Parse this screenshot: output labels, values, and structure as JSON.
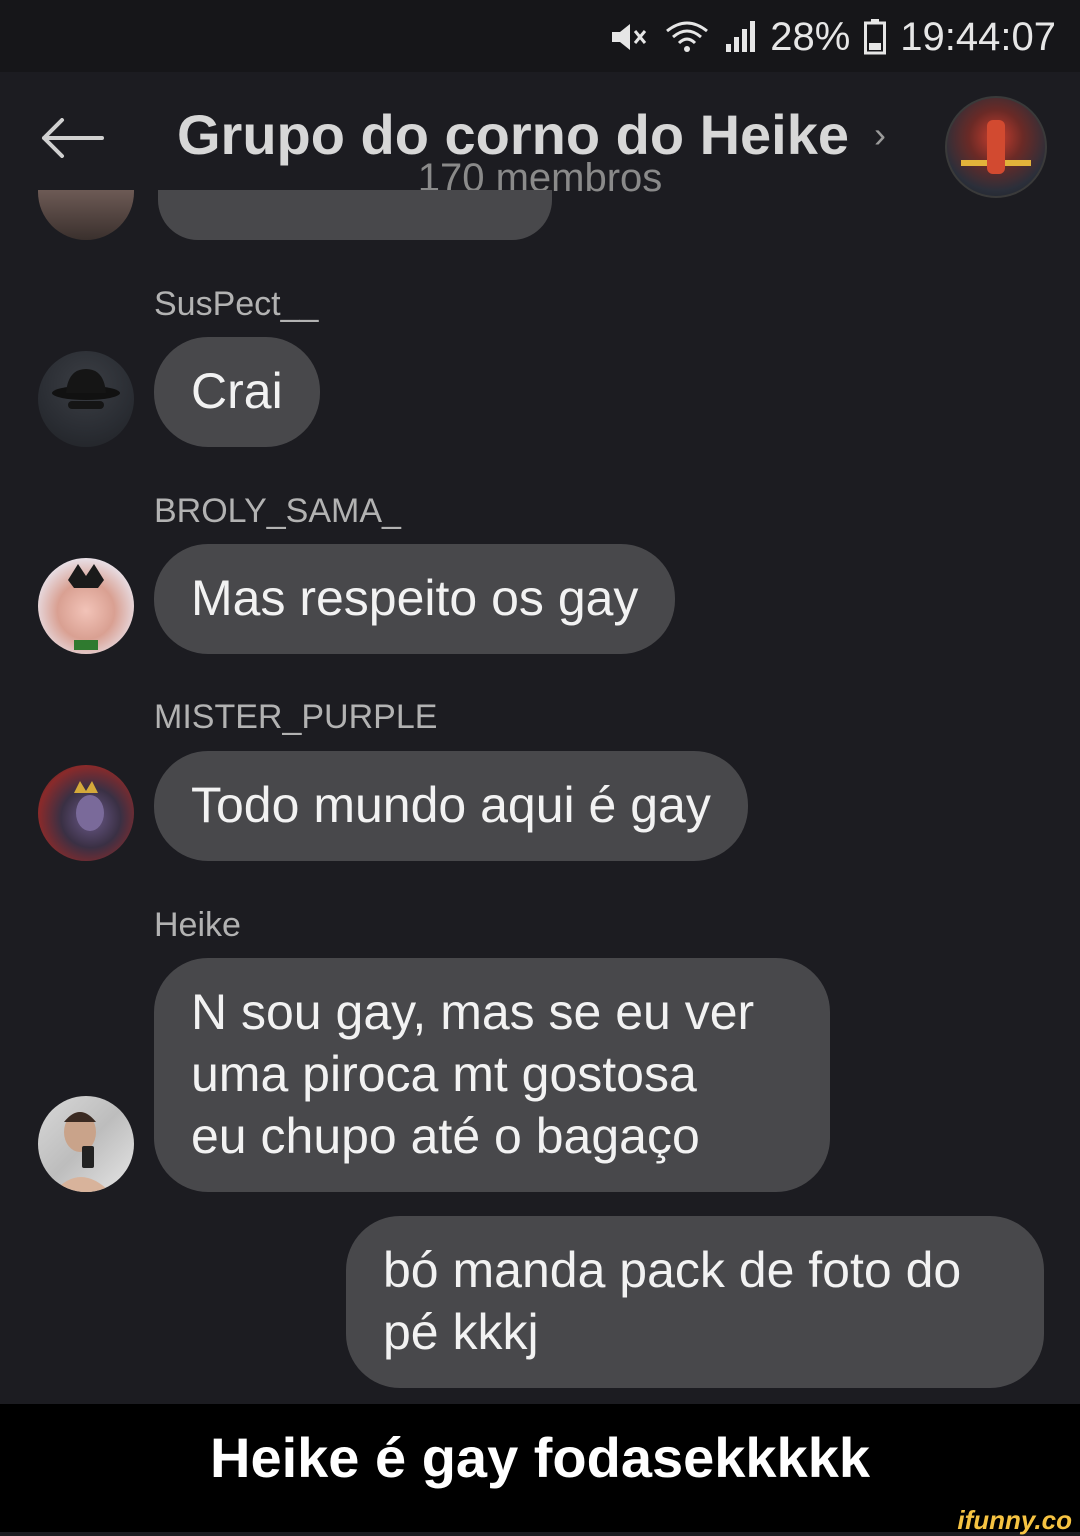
{
  "status_bar": {
    "battery": "28%",
    "time": "19:44:07",
    "icons": [
      "mute-icon",
      "wifi-icon",
      "signal-icon",
      "battery-icon"
    ]
  },
  "header": {
    "title": "Grupo do corno do Heike",
    "subtitle": "170 membros",
    "chevron": "›",
    "icons": [
      "back-arrow-icon",
      "chevron-right-icon"
    ]
  },
  "messages": [
    {
      "sender": "SusPect__",
      "text": "Crai"
    },
    {
      "sender": "BROLY_SAMA_",
      "text": "Mas respeito os gay"
    },
    {
      "sender": "MISTER_PURPLE",
      "text": "Todo mundo aqui é gay"
    },
    {
      "sender": "Heike",
      "lines": [
        "N sou gay, mas se eu ver",
        "uma piroca mt gostosa",
        "eu chupo até o bagaço"
      ]
    }
  ],
  "own_message": {
    "lines": [
      "bó manda pack de foto do",
      "pé kkkj"
    ]
  },
  "caption": "Heike é gay fodasekkkkk",
  "watermark": "ifunny.co",
  "colors": {
    "background": "#1c1c21",
    "bubble": "#48484b",
    "watermark": "#f6c342"
  }
}
